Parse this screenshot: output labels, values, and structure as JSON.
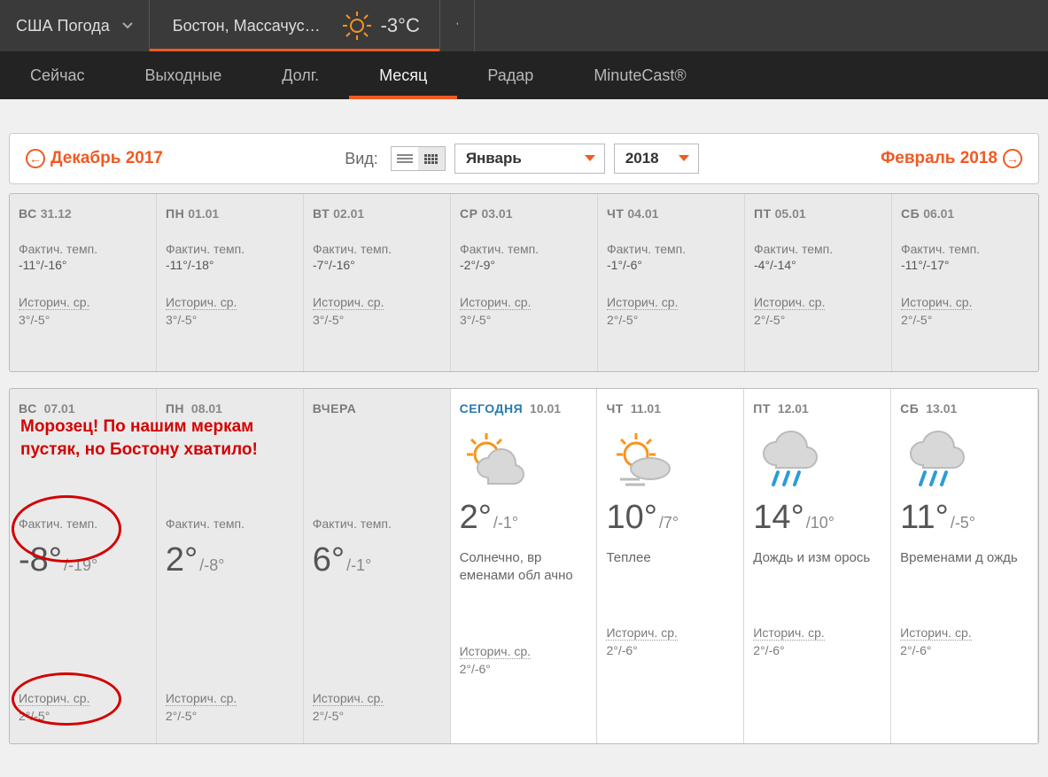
{
  "header": {
    "country_label": "США Погода",
    "location": "Бостон, Массачус…",
    "current_temp": "-3°C"
  },
  "nav": {
    "items": [
      "Сейчас",
      "Выходные",
      "Долг.",
      "Месяц",
      "Радар",
      "MinuteCast®"
    ],
    "active_index": 3
  },
  "controls": {
    "prev": "Декабрь 2017",
    "next": "Февраль 2018",
    "view_label": "Вид:",
    "month": "Январь",
    "year": "2018"
  },
  "labels": {
    "actual": "Фактич. темп.",
    "historic": "Историч. ср.",
    "yesterday": "ВЧЕРА",
    "today": "СЕГОДНЯ"
  },
  "annotations": {
    "line1": "Морозец! По нашим меркам",
    "line2": "пустяк, но Бостону хватило!"
  },
  "week1": [
    {
      "dow": "ВС",
      "date": "31.12",
      "actual": "-11°/-16°",
      "hist": "3°/-5°"
    },
    {
      "dow": "ПН",
      "date": "01.01",
      "actual": "-11°/-18°",
      "hist": "3°/-5°"
    },
    {
      "dow": "ВТ",
      "date": "02.01",
      "actual": "-7°/-16°",
      "hist": "3°/-5°"
    },
    {
      "dow": "СР",
      "date": "03.01",
      "actual": "-2°/-9°",
      "hist": "3°/-5°"
    },
    {
      "dow": "ЧТ",
      "date": "04.01",
      "actual": "-1°/-6°",
      "hist": "2°/-5°"
    },
    {
      "dow": "ПТ",
      "date": "05.01",
      "actual": "-4°/-14°",
      "hist": "2°/-5°"
    },
    {
      "dow": "СБ",
      "date": "06.01",
      "actual": "-11°/-17°",
      "hist": "2°/-5°"
    }
  ],
  "week2": [
    {
      "dow": "ВС",
      "date": "07.01",
      "hi": "-8°",
      "lo": "/-19°",
      "hist": "2°/-5°",
      "type": "past"
    },
    {
      "dow": "ПН",
      "date": "08.01",
      "hi": "2°",
      "lo": "/-8°",
      "hist": "2°/-5°",
      "type": "past"
    },
    {
      "dow_override": "ВЧЕРА",
      "date": "",
      "hi": "6°",
      "lo": "/-1°",
      "hist": "2°/-5°",
      "type": "past"
    },
    {
      "dow_override": "СЕГОДНЯ",
      "date": "10.01",
      "hi": "2°",
      "lo": "/-1°",
      "hist": "2°/-6°",
      "cond": "Солнечно, вр еменами обл ачно",
      "icon": "partly-sunny",
      "type": "forecast",
      "today": true
    },
    {
      "dow": "ЧТ",
      "date": "11.01",
      "hi": "10°",
      "lo": "/7°",
      "hist": "2°/-6°",
      "cond": "Теплее",
      "icon": "hazy-sun",
      "type": "forecast"
    },
    {
      "dow": "ПТ",
      "date": "12.01",
      "hi": "14°",
      "lo": "/10°",
      "hist": "2°/-6°",
      "cond": "Дождь и изм орось",
      "icon": "rain",
      "type": "forecast"
    },
    {
      "dow": "СБ",
      "date": "13.01",
      "hi": "11°",
      "lo": "/-5°",
      "hist": "2°/-6°",
      "cond": "Временами д ождь",
      "icon": "rain",
      "type": "forecast"
    }
  ]
}
